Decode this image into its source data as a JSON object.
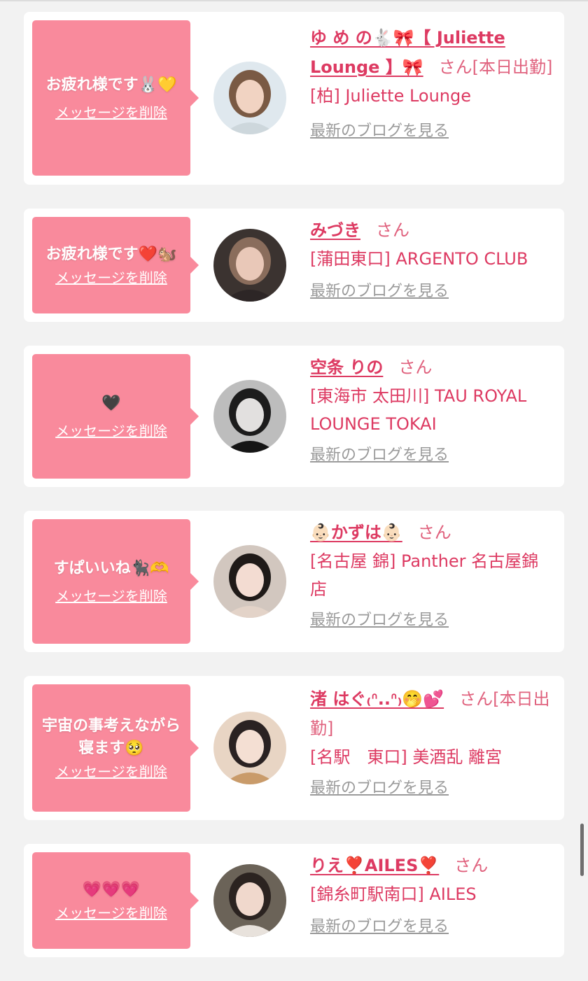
{
  "cards": [
    {
      "message": "お疲れ様です🐰💛",
      "delete_label": "メッセージを削除",
      "name": "ゆ め の🐇🎀【 Juliette Lounge 】🎀",
      "suffix": "さん[本日出勤]",
      "shop": "[柏] Juliette Lounge",
      "blog_label": "最新のブログを見る",
      "avatar_colors": {
        "bg": "#dfe8ee",
        "hair": "#7a5a44",
        "skin": "#f1d3c2",
        "cloth": "#cdd7dc"
      }
    },
    {
      "message": "お疲れ様です❤️🐿️",
      "delete_label": "メッセージを削除",
      "name": "みづき",
      "suffix": "さん",
      "shop": "[蒲田東口] ARGENTO CLUB",
      "blog_label": "最新のブログを見る",
      "avatar_colors": {
        "bg": "#3b3330",
        "hair": "#8a6d5c",
        "skin": "#e9c8b8",
        "cloth": "#2d2626"
      }
    },
    {
      "message": "🖤",
      "delete_label": "メッセージを削除",
      "name": "空条 りの",
      "suffix": "さん",
      "shop": "[東海市 太田川] TAU ROYAL LOUNGE TOKAI",
      "blog_label": "最新のブログを見る",
      "avatar_colors": {
        "bg": "#bdbdbd",
        "hair": "#1c1c1c",
        "skin": "#e2e0df",
        "cloth": "#151515"
      }
    },
    {
      "message": "すぱいいね🐈‍⬛🫶",
      "delete_label": "メッセージを削除",
      "name": "👶🏻かずは👶🏻",
      "suffix": "さん",
      "shop": "[名古屋 錦] Panther 名古屋錦店",
      "blog_label": "最新のブログを見る",
      "avatar_colors": {
        "bg": "#d2c7bf",
        "hair": "#1f1a18",
        "skin": "#f3dcd2",
        "cloth": "#e3d3c8"
      }
    },
    {
      "message": "宇宙の事考えながら寝ます🥺",
      "delete_label": "メッセージを削除",
      "name": "渚 はぐ₍ᐢ..ᐢ₎🤭💕",
      "suffix": "さん[本日出勤]",
      "shop": "[名駅　東口] 美酒乱 離宮",
      "blog_label": "最新のブログを見る",
      "avatar_colors": {
        "bg": "#e8d5c4",
        "hair": "#2a2222",
        "skin": "#f4dfd3",
        "cloth": "#c99b6a"
      }
    },
    {
      "message": "💗💗💗",
      "delete_label": "メッセージを削除",
      "name": "りえ❣️AILES❣️",
      "suffix": "さん",
      "shop": "[錦糸町駅南口] AILES",
      "blog_label": "最新のブログを見る",
      "avatar_colors": {
        "bg": "#6b6358",
        "hair": "#2b2320",
        "skin": "#f0d8cc",
        "cloth": "#e8e2dc"
      }
    }
  ]
}
